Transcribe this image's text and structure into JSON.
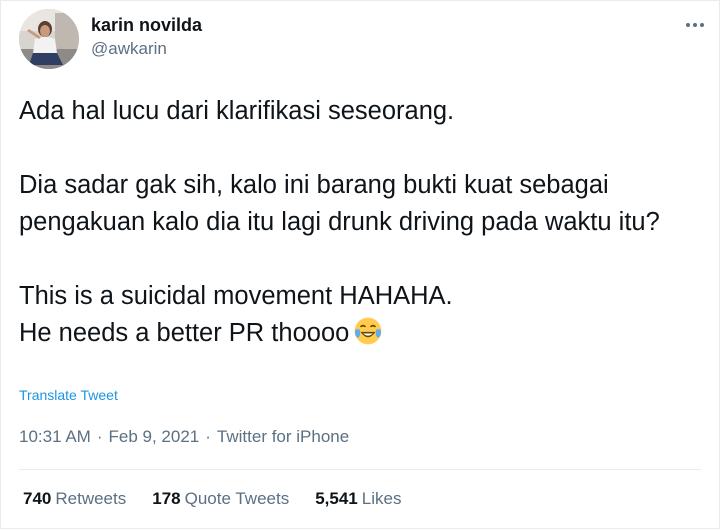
{
  "author": {
    "name": "karin novilda",
    "handle": "@awkarin"
  },
  "menu": {
    "icon": "more-horizontal-icon"
  },
  "tweet": {
    "paragraphs": [
      "Ada hal lucu dari klarifikasi seseorang.",
      "Dia sadar gak sih, kalo ini barang bukti kuat sebagai pengakuan kalo dia itu lagi drunk driving pada waktu itu?"
    ],
    "line3": "This is a suicidal movement HAHAHA.",
    "line4": "He needs a better PR thoooo",
    "emoji": "face-with-tears-of-joy"
  },
  "translate_label": "Translate Tweet",
  "meta": {
    "time": "10:31 AM",
    "date": "Feb 9, 2021",
    "source": "Twitter for iPhone",
    "separator": "·"
  },
  "stats": {
    "retweets": {
      "count": "740",
      "label": "Retweets"
    },
    "quotes": {
      "count": "178",
      "label": "Quote Tweets"
    },
    "likes": {
      "count": "5,541",
      "label": "Likes"
    }
  },
  "colors": {
    "text": "#0f1419",
    "secondary": "#5b7083",
    "link": "#1b95e0",
    "border": "#e6ecf0"
  }
}
